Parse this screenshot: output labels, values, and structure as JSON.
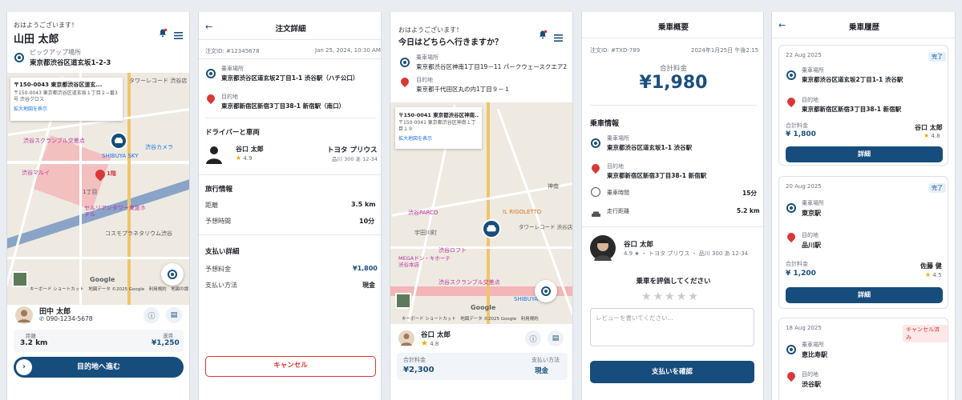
{
  "s1": {
    "greeting": "おはようございます！",
    "user_name": "山田 太郎",
    "pickup_label": "ピックアップ場所",
    "pickup_address": "東京都渋谷区道玄坂1-2-3",
    "map_card": {
      "title": "〒150-0043 東京都渋谷区道玄...",
      "address": "〒150-0043 東京都渋谷区道玄坂１丁目２−番3号 渋谷クロス",
      "link": "拡大地図を表示"
    },
    "map_labels": {
      "tower": "タワーレコード 渋谷店",
      "scramble": "渋谷スクランブル交差点",
      "camera": "渋谷カメラ",
      "marui": "渋谷マルイ",
      "shibuya_sky": "SHIBUYA SKY",
      "cerulean": "セルリアンタワー東急ホテル",
      "cosmo": "コスモプラネタリウム渋谷",
      "chome": "1丁目",
      "pin": "1階",
      "google": "Google",
      "attribution": "キーボード ショートカット　地図データ ©2025 Google　利用規約　地図の誤りを報告する"
    },
    "driver_name": "田中 太郎",
    "driver_phone": "090-1234-5678",
    "distance_label": "距離",
    "distance_value": "3.2 km",
    "fare_label": "運賃",
    "fare_value": "¥1,250",
    "cta": "目的地へ進む"
  },
  "s2": {
    "title": "注文詳細",
    "order_id": "注文ID: #12345678",
    "order_date": "Jan 25, 2024, 10:30 AM",
    "pickup_label": "乗車場所",
    "pickup_address": "東京都渋谷区道玄坂2丁目1-1 渋谷駅（ハチ公口）",
    "dest_label": "目的地",
    "dest_address": "東京都新宿区新宿3丁目38-1 新宿駅（南口）",
    "driver_section": "ドライバーと車両",
    "driver_name": "谷口 太郎",
    "driver_rating": "4.9",
    "car_model": "トヨタ プリウス",
    "car_plate": "品川 300 あ 12-34",
    "trip_section": "旅行情報",
    "distance_label": "距離",
    "distance_value": "3.5 km",
    "time_label": "予想時間",
    "time_value": "10分",
    "pay_section": "支払い詳細",
    "est_fare_label": "予想料金",
    "est_fare_value": "¥1,800",
    "pay_method_label": "支払い方法",
    "pay_method_value": "現金",
    "cancel": "キャンセル"
  },
  "s3": {
    "greeting": "おはようございます！",
    "question": "今日はどちらへ行きますか？",
    "pickup_label": "乗車場所",
    "pickup_address": "東京都渋谷区神南1丁目19－11 パークウェースクエア2",
    "dest_label": "目的地",
    "dest_address": "東京都千代田区丸の内1丁目９－１",
    "map_card": {
      "title": "〒150-0041 東京都渋谷区神南...",
      "address": "〒150-0041 東京都渋谷区神南１丁目１９",
      "link": "拡大地図を表示"
    },
    "map_labels": {
      "parco": "渋谷PARCO",
      "rigoletto": "IL RIGOLETTO",
      "tower": "タワーレコード 渋谷店",
      "udagawa": "宇田川町",
      "loft": "渋谷ロフト",
      "mega": "MEGAドン・キホーテ 渋谷本店",
      "scramble": "渋谷スクランブル交差点",
      "sky": "SHIBUYA SKY",
      "jinnan": "神南",
      "google": "Google",
      "attribution": "キーボード ショートカット　地図データ ©2025 Google　利用規約"
    },
    "driver_name": "谷口 太郎",
    "driver_rating": "4.8",
    "total_label": "合計料金",
    "total_value": "¥2,300",
    "pay_label": "支払い方法",
    "pay_value": "現金"
  },
  "s4": {
    "title": "乗車概要",
    "order_id": "注文ID: #TXD-789",
    "order_date": "2024年1月25日 午後2:15",
    "total_label": "合計料金",
    "total_value": "¥1,980",
    "ride_info": "乗車情報",
    "pickup_label": "乗車場所",
    "pickup_address": "東京都渋谷区道玄坂1-1 渋谷駅",
    "dest_label": "目的地",
    "dest_address": "東京都新宿区新宿3丁目38-1 新宿駅",
    "time_label": "乗車時間",
    "time_value": "15分",
    "distance_label": "走行距離",
    "distance_value": "5.2 km",
    "driver_name": "谷口 太郎",
    "driver_detail": "4.9 ★ ・ トヨタ プリウス ・ 品川 300 あ 12-34",
    "rate_prompt": "乗車を評価してください",
    "review_placeholder": "レビューを書いてください...",
    "confirm": "支払いを確認"
  },
  "s5": {
    "title": "乗車履歴",
    "cards": [
      {
        "date": "22 Aug 2025",
        "status": "完了",
        "pickup_label": "乗車場所",
        "pickup": "東京都渋谷区道玄坂2丁目1-1 渋谷駅",
        "dest_label": "目的地",
        "dest": "東京都新宿区新宿3丁目38-1 新宿駅",
        "total_label": "合計料金",
        "total": "¥ 1,800",
        "driver": "谷口 太郎",
        "rating": "4.8",
        "button": "詳細"
      },
      {
        "date": "20 Aug 2025",
        "status": "完了",
        "pickup_label": "乗車場所",
        "pickup": "東京駅",
        "dest_label": "目的地",
        "dest": "品川駅",
        "total_label": "合計料金",
        "total": "¥ 1,200",
        "driver": "佐藤 健",
        "rating": "4.5",
        "button": "詳細"
      },
      {
        "date": "18 Aug 2025",
        "status": "キャンセル済み",
        "pickup_label": "乗車場所",
        "pickup": "恵比寿駅",
        "dest_label": "目的地",
        "dest": "渋谷駅",
        "total_label": "",
        "total": "",
        "driver": "",
        "rating": "",
        "button": ""
      }
    ]
  },
  "colors": {
    "navy": "#174d7c",
    "red": "#d93838",
    "star": "#f2a900",
    "green_badge": "#e3f0fb"
  }
}
